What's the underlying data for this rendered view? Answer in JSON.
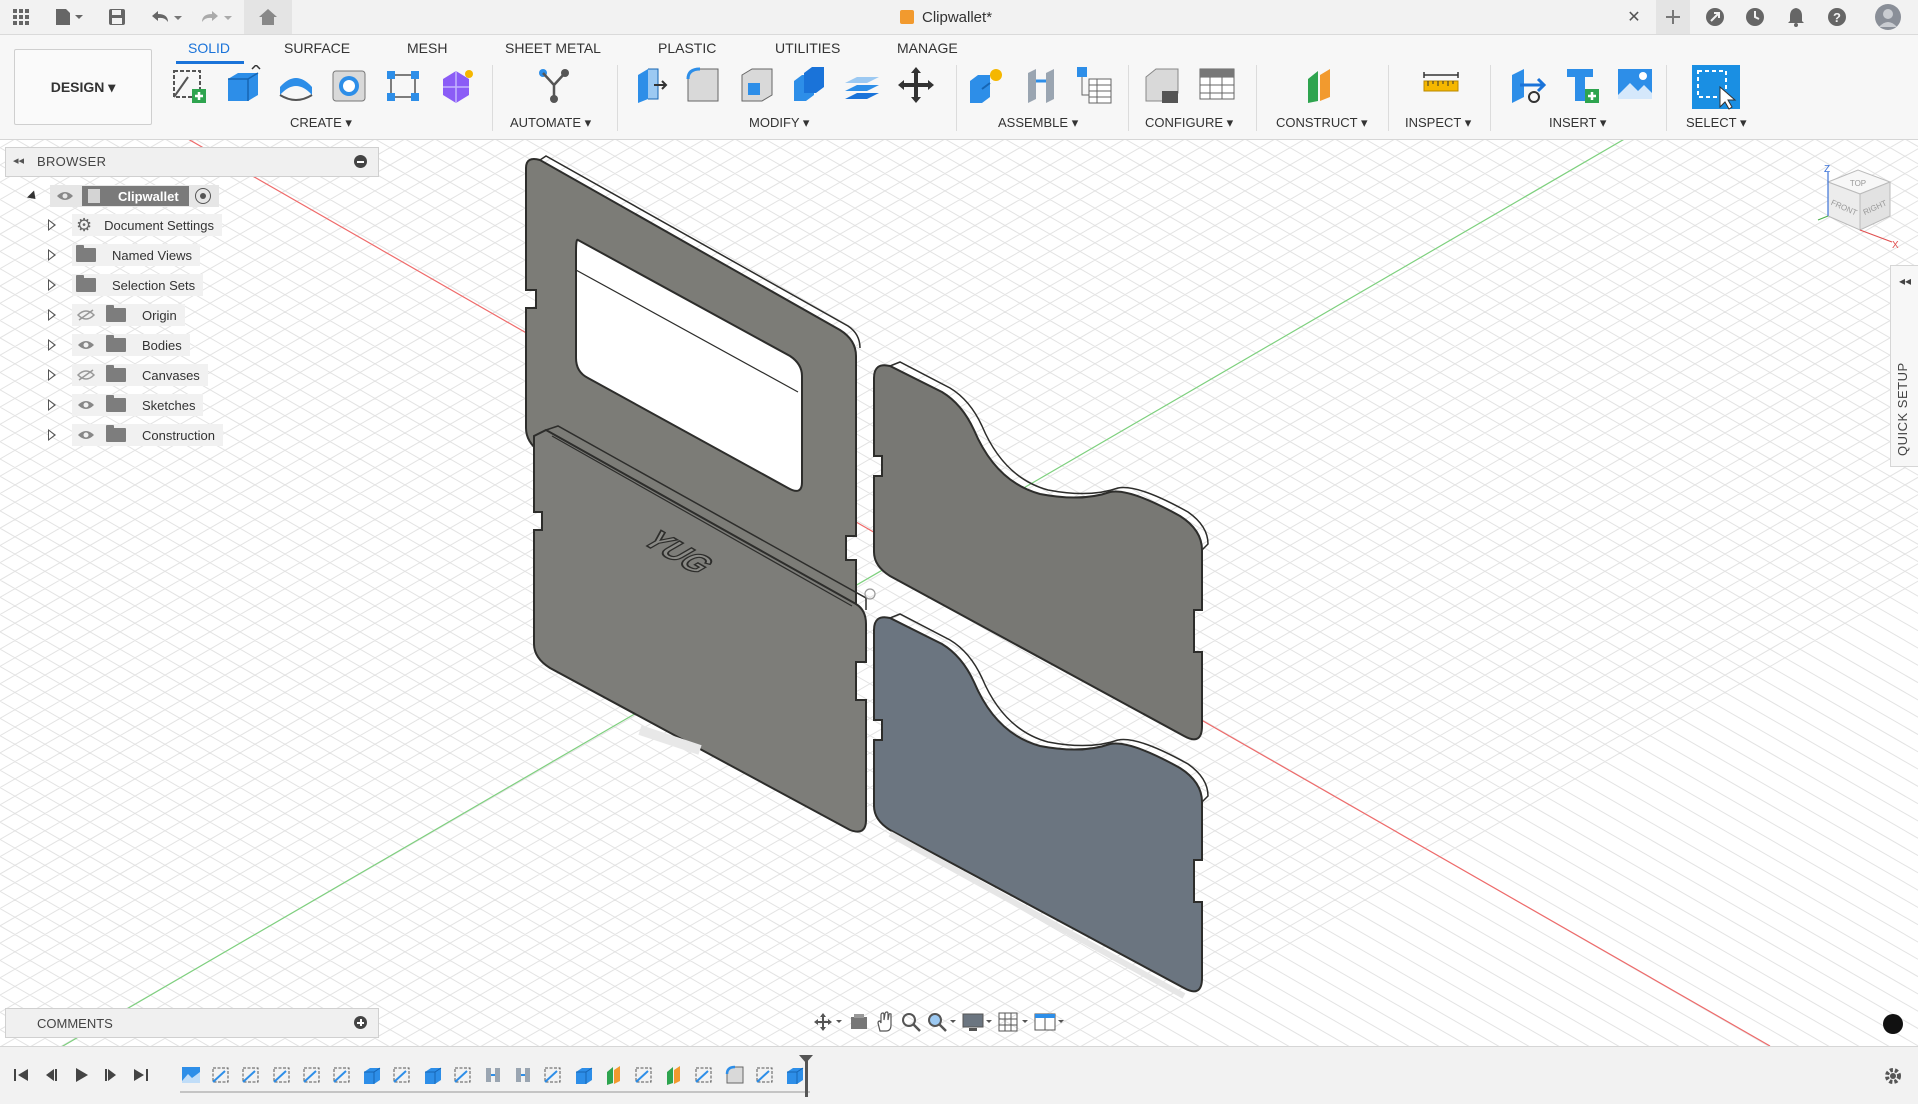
{
  "titlebar": {
    "document_title": "Clipwallet*",
    "close_symbol": "✕",
    "icons": [
      "apps-grid-icon",
      "file-menu-icon",
      "save-icon",
      "undo-icon",
      "redo-icon",
      "home-icon",
      "new-tab-icon",
      "extensions-icon",
      "job-status-icon",
      "notifications-icon",
      "help-icon",
      "user-avatar-icon"
    ]
  },
  "toolbar": {
    "workspace_button": "DESIGN ▾",
    "tabs": [
      {
        "label": "SOLID",
        "active": true
      },
      {
        "label": "SURFACE",
        "active": false
      },
      {
        "label": "MESH",
        "active": false
      },
      {
        "label": "SHEET METAL",
        "active": false
      },
      {
        "label": "PLASTIC",
        "active": false
      },
      {
        "label": "UTILITIES",
        "active": false
      },
      {
        "label": "MANAGE",
        "active": false
      }
    ],
    "groups": [
      {
        "label": "CREATE ▾"
      },
      {
        "label": "AUTOMATE ▾"
      },
      {
        "label": "MODIFY ▾"
      },
      {
        "label": "ASSEMBLE ▾"
      },
      {
        "label": "CONFIGURE ▾"
      },
      {
        "label": "CONSTRUCT ▾"
      },
      {
        "label": "INSPECT ▾"
      },
      {
        "label": "INSERT ▾"
      },
      {
        "label": "SELECT ▾"
      }
    ],
    "accent_color": "#1a73d9"
  },
  "browser": {
    "title": "BROWSER",
    "root": "Clipwallet",
    "items": [
      {
        "label": "Document Settings",
        "icon": "gear-icon"
      },
      {
        "label": "Named Views",
        "icon": "folder-icon"
      },
      {
        "label": "Selection Sets",
        "icon": "folder-icon"
      },
      {
        "label": "Origin",
        "icon": "folder-icon",
        "visibility": "hidden"
      },
      {
        "label": "Bodies",
        "icon": "folder-icon",
        "visibility": "visible"
      },
      {
        "label": "Canvases",
        "icon": "folder-icon",
        "visibility": "hidden"
      },
      {
        "label": "Sketches",
        "icon": "folder-icon",
        "visibility": "visible"
      },
      {
        "label": "Construction",
        "icon": "folder-icon",
        "visibility": "visible"
      }
    ]
  },
  "viewport": {
    "embossed_text": "YUG",
    "quick_setup_label": "QUICK SETUP",
    "viewcube": {
      "top": "TOP",
      "front": "FRONT",
      "right": "RIGHT",
      "axis_z": "Z",
      "axis_x": "X"
    }
  },
  "comments": {
    "title": "COMMENTS"
  },
  "timeline": {
    "feature_count": 21
  }
}
